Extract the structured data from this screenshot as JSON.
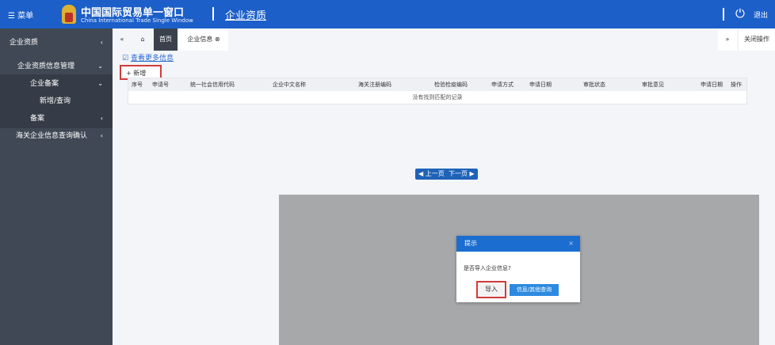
{
  "header": {
    "menu_label": "菜单",
    "title": "中国国际贸易单一窗口",
    "subtitle": "China International Trade Single Window",
    "section": "企业资质",
    "logout_label": "退出"
  },
  "sidebar": {
    "items": [
      {
        "label": "企业资质",
        "chevron": "‹"
      },
      {
        "label": "企业资质信息管理",
        "chevron": "⌄"
      },
      {
        "label": "企业备案",
        "chevron": "⌄"
      },
      {
        "label": "新增/查询",
        "chevron": ""
      },
      {
        "label": "备案",
        "chevron": "‹"
      },
      {
        "label": "海关企业信息查询确认",
        "chevron": "‹"
      }
    ]
  },
  "tabs": [
    {
      "label": "«"
    },
    {
      "label": "⌂"
    },
    {
      "label": "首页"
    },
    {
      "label": "企业信息 ⊗"
    }
  ],
  "tabs_right": {
    "next": "»",
    "close": "关闭操作"
  },
  "toolbar": {
    "link": "查看更多信息",
    "add_label": "+ 新增"
  },
  "table": {
    "headers": [
      "序号",
      "申请号",
      "统一社会信用代码",
      "企业中文名称",
      "海关注册编码",
      "检验检疫编码",
      "申请方式",
      "申请日期",
      "审批状态",
      "审批意见",
      "申请日期",
      "操作"
    ],
    "empty": "没有找到匹配的记录"
  },
  "pagination": {
    "prev": "◀ 上一页",
    "next": "下一页 ▶"
  },
  "dialog": {
    "title": "提示",
    "close": "×",
    "message": "是否导入企业信息?",
    "import_label": "导入",
    "other_label": "信息/其他查询"
  }
}
